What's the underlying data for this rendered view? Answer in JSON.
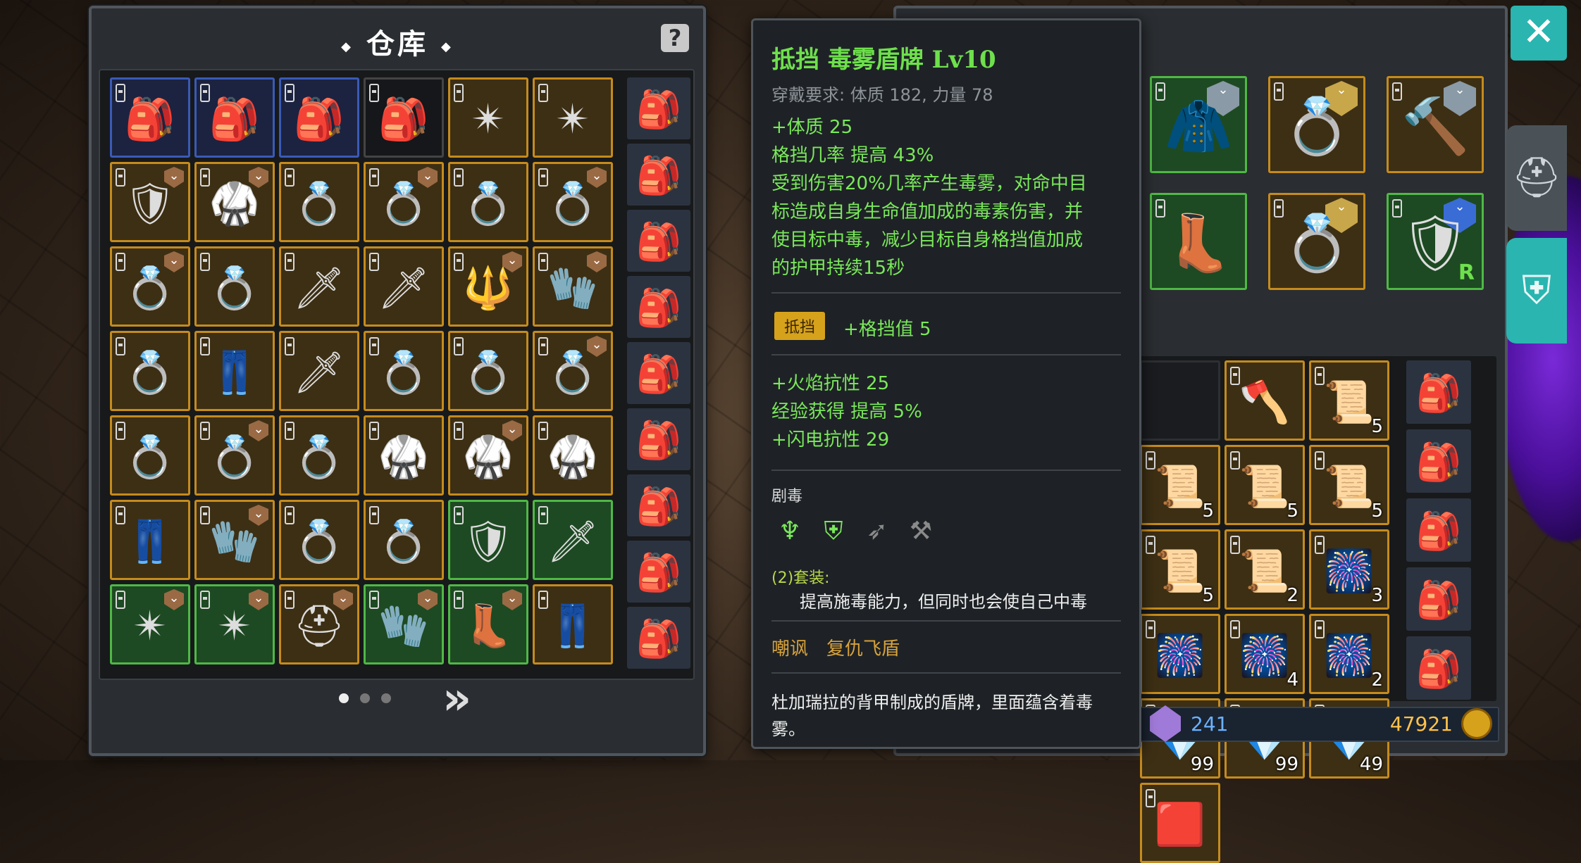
{
  "warehouse": {
    "title": "仓库",
    "help": "?",
    "grid": [
      {
        "frame": "blue",
        "icon": "🎒",
        "name": "backpack-icon",
        "badge": false
      },
      {
        "frame": "blue",
        "icon": "🎒",
        "name": "backpack-icon",
        "badge": false
      },
      {
        "frame": "blue",
        "icon": "🎒",
        "name": "backpack-icon",
        "badge": false
      },
      {
        "frame": "black",
        "icon": "🎒",
        "name": "pouch-icon",
        "badge": false
      },
      {
        "frame": "gold",
        "icon": "✴",
        "name": "amulet-icon",
        "badge": false
      },
      {
        "frame": "gold",
        "icon": "✴",
        "name": "amulet-icon",
        "badge": false
      },
      {
        "frame": "gold",
        "icon": "🛡",
        "name": "armor-icon",
        "badge": true
      },
      {
        "frame": "gold",
        "icon": "🥋",
        "name": "robe-icon",
        "badge": true
      },
      {
        "frame": "gold",
        "icon": "💍",
        "name": "ring-icon",
        "badge": false
      },
      {
        "frame": "gold",
        "icon": "💍",
        "name": "ring-icon",
        "badge": true
      },
      {
        "frame": "gold",
        "icon": "💍",
        "name": "ring-icon",
        "badge": false
      },
      {
        "frame": "gold",
        "icon": "💍",
        "name": "ring-icon",
        "badge": true
      },
      {
        "frame": "gold",
        "icon": "💍",
        "name": "ring-icon",
        "badge": true
      },
      {
        "frame": "gold",
        "icon": "💍",
        "name": "ring-icon",
        "badge": false
      },
      {
        "frame": "gold",
        "icon": "🗡",
        "name": "spear-icon",
        "badge": false
      },
      {
        "frame": "gold",
        "icon": "🗡",
        "name": "spear-icon",
        "badge": false
      },
      {
        "frame": "gold",
        "icon": "🔱",
        "name": "staff-icon",
        "badge": true
      },
      {
        "frame": "gold",
        "icon": "🧤",
        "name": "glove-icon",
        "badge": true
      },
      {
        "frame": "gold",
        "icon": "💍",
        "name": "ring-icon",
        "badge": false
      },
      {
        "frame": "gold",
        "icon": "👖",
        "name": "leggings-icon",
        "badge": false
      },
      {
        "frame": "gold",
        "icon": "🗡",
        "name": "sword-icon",
        "badge": false
      },
      {
        "frame": "gold",
        "icon": "💍",
        "name": "ring-icon",
        "badge": false
      },
      {
        "frame": "gold",
        "icon": "💍",
        "name": "ring-icon",
        "badge": false
      },
      {
        "frame": "gold",
        "icon": "💍",
        "name": "ring-icon",
        "badge": true
      },
      {
        "frame": "gold",
        "icon": "💍",
        "name": "ring-icon",
        "badge": false
      },
      {
        "frame": "gold",
        "icon": "💍",
        "name": "ring-icon",
        "badge": true
      },
      {
        "frame": "gold",
        "icon": "💍",
        "name": "ring-icon",
        "badge": false
      },
      {
        "frame": "gold",
        "icon": "🥋",
        "name": "robe-icon",
        "badge": false
      },
      {
        "frame": "gold",
        "icon": "🥋",
        "name": "robe-icon",
        "badge": true
      },
      {
        "frame": "gold",
        "icon": "🥋",
        "name": "robe-icon",
        "badge": false
      },
      {
        "frame": "gold",
        "icon": "👖",
        "name": "leggings-icon",
        "badge": false
      },
      {
        "frame": "gold",
        "icon": "🧤",
        "name": "glove-icon",
        "badge": true
      },
      {
        "frame": "gold",
        "icon": "💍",
        "name": "ring-icon",
        "badge": false
      },
      {
        "frame": "gold",
        "icon": "💍",
        "name": "ring-icon",
        "badge": false
      },
      {
        "frame": "green",
        "icon": "🛡",
        "name": "shield-icon",
        "badge": false
      },
      {
        "frame": "green",
        "icon": "🗡",
        "name": "spear-icon",
        "badge": false
      },
      {
        "frame": "green",
        "icon": "✴",
        "name": "amulet-icon",
        "badge": true
      },
      {
        "frame": "green",
        "icon": "✴",
        "name": "amulet-icon",
        "badge": true
      },
      {
        "frame": "gold",
        "icon": "⛑",
        "name": "helmet-icon",
        "badge": true
      },
      {
        "frame": "green",
        "icon": "🧤",
        "name": "glove-icon",
        "badge": true
      },
      {
        "frame": "green",
        "icon": "👢",
        "name": "boots-icon",
        "badge": true
      },
      {
        "frame": "gold",
        "icon": "👖",
        "name": "leggings-icon",
        "badge": false
      }
    ],
    "side_items": [
      "🎒",
      "🎒",
      "🎒",
      "🎒",
      "🎒",
      "🎒",
      "🎒",
      "🎒",
      "🎒"
    ],
    "next_icon": "»"
  },
  "tooltip": {
    "title": "抵挡 毒雾盾牌 Lv10",
    "requirement": "穿戴要求:   体质 182, 力量 78",
    "stats1": [
      "+体质 25",
      "格挡几率 提高 43%",
      "受到伤害20%几率产生毒雾，对命中目",
      "标造成自身生命值加成的毒素伤害，并",
      "使目标中毒，减少目标自身格挡值加成",
      "的护甲持续15秒"
    ],
    "block_tag": "抵挡",
    "block_value": "+格挡值 5",
    "stats2": [
      "+火焰抗性 25",
      "经验获得 提高 5%",
      "+闪电抗性 29"
    ],
    "set_name": "剧毒",
    "set_icons": [
      {
        "icon": "♆",
        "name": "necklace-icon",
        "on": true
      },
      {
        "icon": "⛨",
        "name": "shield-set-icon",
        "on": true
      },
      {
        "icon": "➶",
        "name": "spear-set-icon",
        "on": false
      },
      {
        "icon": "⚒",
        "name": "axe-set-icon",
        "on": false
      }
    ],
    "set_bonus_head": "(2)套装:",
    "set_bonus_desc": "提高施毒能力，但同时也会使自己中毒",
    "links": [
      "嘲讽",
      "复仇飞盾"
    ],
    "flavor": "杜加瑞拉的背甲制成的盾牌，里面蕴含着毒雾。"
  },
  "equip": {
    "slots": [
      {
        "icon": "🧥",
        "name": "cloak-icon",
        "badge": "silver"
      },
      {
        "icon": "💍",
        "name": "ring-icon",
        "badge": "gold"
      },
      {
        "icon": "🔨",
        "name": "mace-icon",
        "badge": "silver"
      },
      {
        "icon": "👢",
        "name": "boots-icon",
        "badge": "none"
      },
      {
        "icon": "💍",
        "name": "ring-icon",
        "badge": "gold"
      },
      {
        "icon": "🛡",
        "name": "shield-icon",
        "badge": "blue",
        "label": "R"
      }
    ]
  },
  "bag": {
    "grid": [
      {
        "icon": "",
        "count": ""
      },
      {
        "icon": "🪓",
        "count": ""
      },
      {
        "icon": "📜",
        "count": "5"
      },
      {
        "icon": "📜",
        "count": "5"
      },
      {
        "icon": "📜",
        "count": "5"
      },
      {
        "icon": "📜",
        "count": "5"
      },
      {
        "icon": "📜",
        "count": "5"
      },
      {
        "icon": "📜",
        "count": "2"
      },
      {
        "icon": "🎆",
        "count": "3"
      },
      {
        "icon": "🎆",
        "count": ""
      },
      {
        "icon": "🎆",
        "count": "4"
      },
      {
        "icon": "🎆",
        "count": "2"
      },
      {
        "icon": "💎",
        "count": "99"
      },
      {
        "icon": "💎",
        "count": "99"
      },
      {
        "icon": "💎",
        "count": "49"
      },
      {
        "icon": "🟥",
        "count": ""
      }
    ],
    "side_items": [
      "🎒",
      "🎒",
      "🎒",
      "🎒",
      "🎒"
    ]
  },
  "currency": {
    "gems": "241",
    "gold": "47921"
  },
  "close": "✕",
  "tabs": [
    "⛑",
    "⛨"
  ]
}
